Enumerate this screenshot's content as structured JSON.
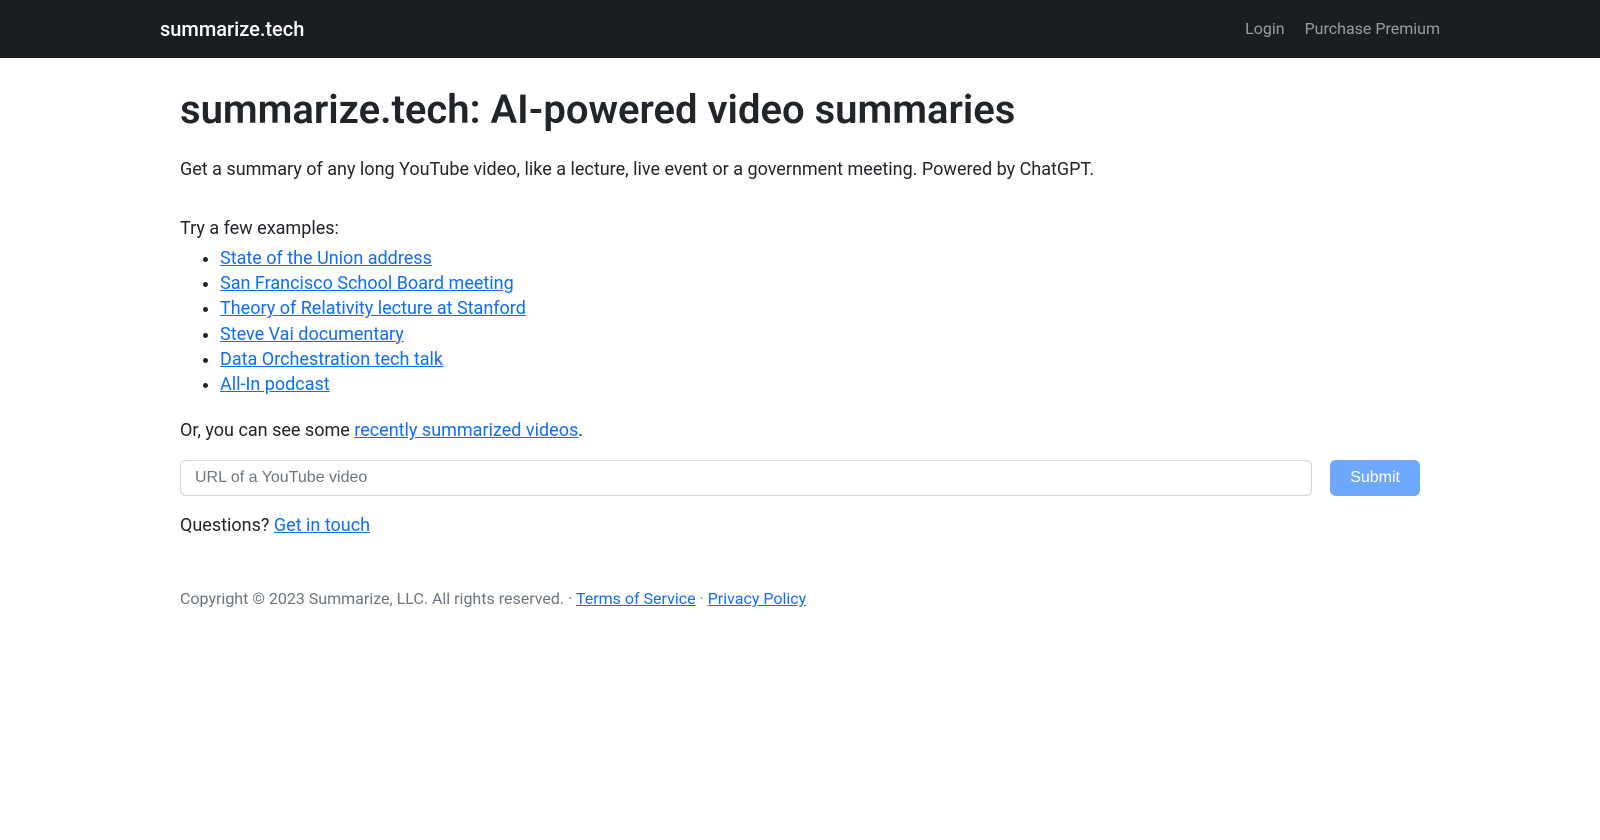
{
  "navbar": {
    "brand": "summarize.tech",
    "login": "Login",
    "premium": "Purchase Premium"
  },
  "main": {
    "title": "summarize.tech: AI-powered video summaries",
    "lead": "Get a summary of any long YouTube video, like a lecture, live event or a government meeting. Powered by ChatGPT.",
    "examples_intro": "Try a few examples:",
    "examples": [
      "State of the Union address",
      "San Francisco School Board meeting",
      "Theory of Relativity lecture at Stanford",
      "Steve Vai documentary",
      "Data Orchestration tech talk",
      "All-In podcast"
    ],
    "or_prefix": "Or, you can see some ",
    "or_link": "recently summarized videos",
    "or_suffix": ".",
    "input_placeholder": "URL of a YouTube video",
    "submit_label": "Submit",
    "questions_prefix": "Questions? ",
    "questions_link": "Get in touch"
  },
  "footer": {
    "copyright": "Copyright © 2023 Summarize, LLC. All rights reserved. · ",
    "tos": "Terms of Service",
    "separator": " · ",
    "privacy": "Privacy Policy"
  }
}
